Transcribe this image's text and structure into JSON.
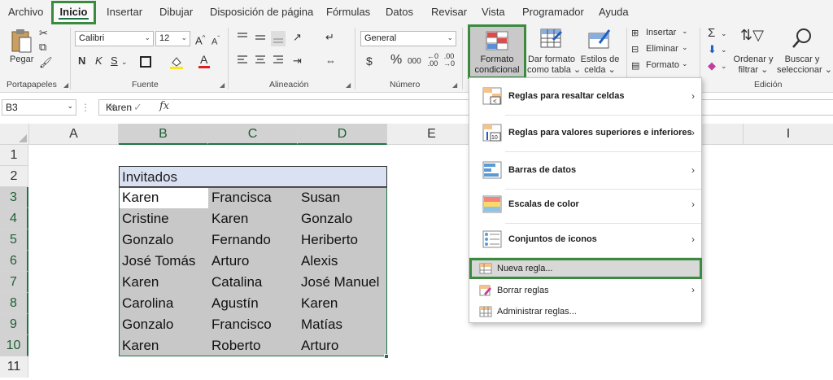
{
  "menubar": {
    "tabs": [
      "Archivo",
      "Inicio",
      "Insertar",
      "Dibujar",
      "Disposición de página",
      "Fórmulas",
      "Datos",
      "Revisar",
      "Vista",
      "Programador",
      "Ayuda"
    ]
  },
  "ribbon": {
    "clipboard": {
      "paste_label": "Pegar",
      "group_label": "Portapapeles"
    },
    "font": {
      "name": "Calibri",
      "size": "12",
      "bold": "N",
      "italic": "K",
      "underline": "S",
      "group_label": "Fuente"
    },
    "alignment": {
      "group_label": "Alineación"
    },
    "number": {
      "format": "General",
      "currency": "$",
      "percent": "%",
      "thousands": "000",
      "group_label": "Número"
    },
    "styles": {
      "conditional_format_line1": "Formato",
      "conditional_format_line2": "condicional",
      "format_table_line1": "Dar formato",
      "format_table_line2": "como tabla",
      "cell_styles_line1": "Estilos de",
      "cell_styles_line2": "celda"
    },
    "cells": {
      "insert": "Insertar",
      "delete": "Eliminar",
      "format": "Formato"
    },
    "editing": {
      "sort_line1": "Ordenar y",
      "sort_line2": "filtrar",
      "find_line1": "Buscar y",
      "find_line2": "seleccionar",
      "group_label": "Edición"
    }
  },
  "formula_bar": {
    "cell_ref": "B3",
    "fx": "fx",
    "value": "Karen"
  },
  "sheet": {
    "columns": [
      "A",
      "B",
      "C",
      "D",
      "E",
      "I"
    ],
    "rows": [
      "1",
      "2",
      "3",
      "4",
      "5",
      "6",
      "7",
      "8",
      "9",
      "10",
      "11"
    ],
    "header": "Invitados",
    "data": [
      [
        "Karen",
        "Francisca",
        "Susan"
      ],
      [
        "Cristine",
        "Karen",
        "Gonzalo"
      ],
      [
        "Gonzalo",
        "Fernando",
        "Heriberto"
      ],
      [
        "José Tomás",
        "Arturo",
        "Alexis"
      ],
      [
        "Karen",
        "Catalina",
        "José Manuel"
      ],
      [
        "Carolina",
        "Agustín",
        "Karen"
      ],
      [
        "Gonzalo",
        "Francisco",
        "Matías"
      ],
      [
        "Karen",
        "Roberto",
        "Arturo"
      ]
    ]
  },
  "menu": {
    "highlight_rules": "Reglas para resaltar celdas",
    "top_bottom_rules": "Reglas para valores superiores e inferiores",
    "data_bars": "Barras de datos",
    "color_scales": "Escalas de color",
    "icon_sets": "Conjuntos de iconos",
    "new_rule": "Nueva regla...",
    "clear_rules": "Borrar reglas",
    "manage_rules": "Administrar reglas..."
  },
  "colors": {
    "accent_green": "#3b8a40",
    "excel_green": "#217346",
    "selection_gray": "#c8c8c8",
    "header_fill": "#d9e1f2"
  }
}
